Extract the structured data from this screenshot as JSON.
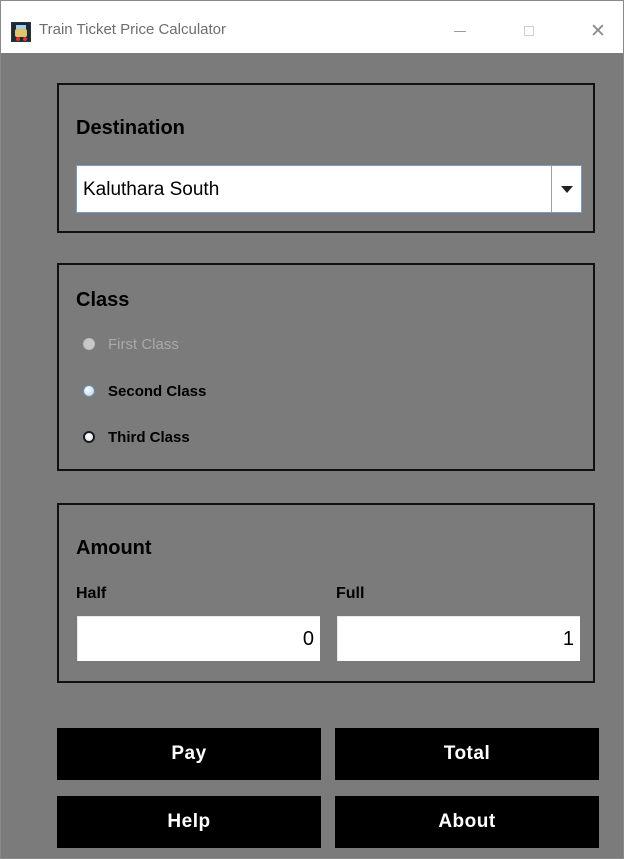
{
  "window": {
    "title": "Train Ticket Price Calculator",
    "icon": "train-icon"
  },
  "destination": {
    "heading": "Destination",
    "selected": "Kaluthara South"
  },
  "class_panel": {
    "heading": "Class",
    "options": [
      {
        "label": "First Class",
        "enabled": false
      },
      {
        "label": "Second Class",
        "enabled": true
      },
      {
        "label": "Third Class",
        "enabled": true,
        "focused": true
      }
    ]
  },
  "amount": {
    "heading": "Amount",
    "half_label": "Half",
    "half_value": "0",
    "full_label": "Full",
    "full_value": "1"
  },
  "buttons": {
    "pay": "Pay",
    "total": "Total",
    "help": "Help",
    "about": "About"
  },
  "colors": {
    "background": "#7b7b7b",
    "button": "#000000",
    "button_text": "#ffffff"
  }
}
